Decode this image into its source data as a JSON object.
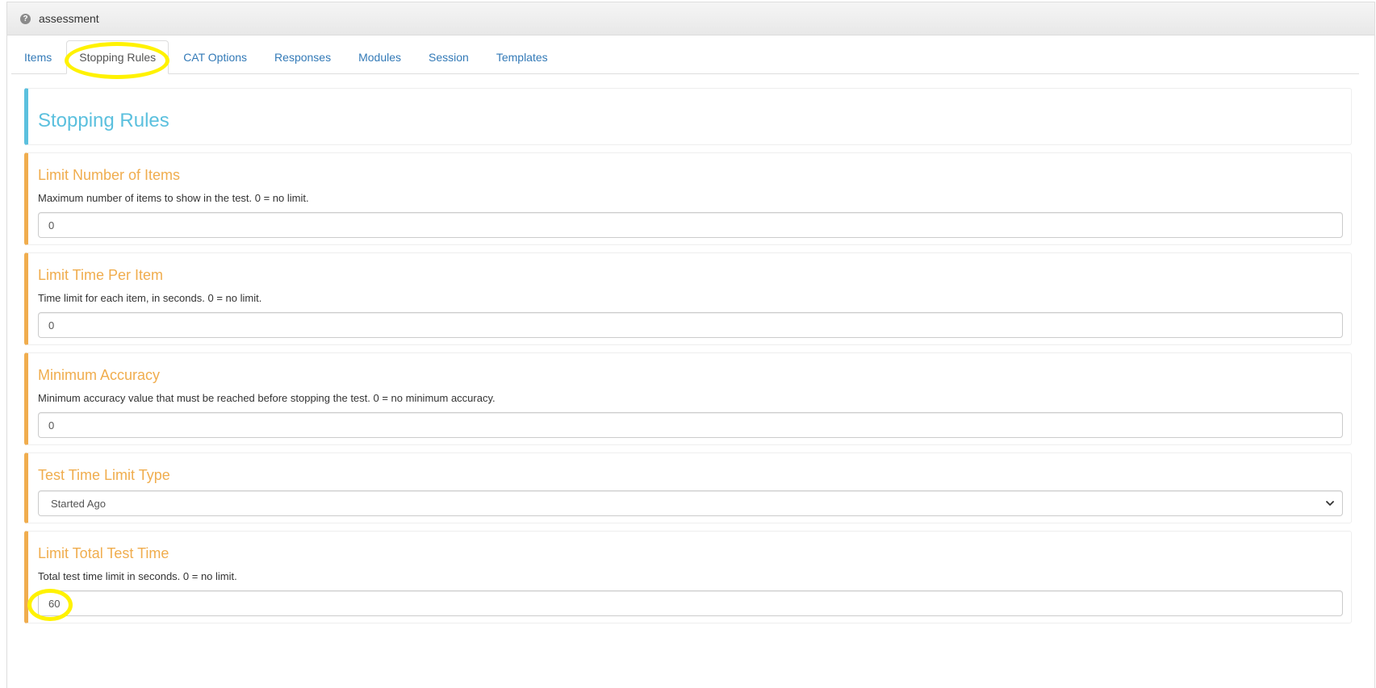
{
  "header": {
    "help_icon": "question-circle-icon",
    "title": "assessment"
  },
  "tabs": [
    {
      "label": "Items"
    },
    {
      "label": "Stopping Rules",
      "active": true
    },
    {
      "label": "CAT Options"
    },
    {
      "label": "Responses"
    },
    {
      "label": "Modules"
    },
    {
      "label": "Session"
    },
    {
      "label": "Templates"
    }
  ],
  "section": {
    "title": "Stopping Rules"
  },
  "rules": {
    "limit_items": {
      "title": "Limit Number of Items",
      "description": "Maximum number of items to show in the test. 0 = no limit.",
      "value": "0"
    },
    "limit_time_per_item": {
      "title": "Limit Time Per Item",
      "description": "Time limit for each item, in seconds. 0 = no limit.",
      "value": "0"
    },
    "min_accuracy": {
      "title": "Minimum Accuracy",
      "description": "Minimum accuracy value that must be reached before stopping the test. 0 = no minimum accuracy.",
      "value": "0"
    },
    "time_limit_type": {
      "title": "Test Time Limit Type",
      "selected": "Started Ago",
      "caret_icon": "chevron-down-icon"
    },
    "limit_total_time": {
      "title": "Limit Total Test Time",
      "description": "Total test time limit in seconds. 0 = no limit.",
      "value": "60"
    }
  },
  "colors": {
    "link": "#337ab7",
    "info_accent": "#5bc0de",
    "warning_accent": "#f0ad4e",
    "annotation_highlight": "#fff200"
  }
}
